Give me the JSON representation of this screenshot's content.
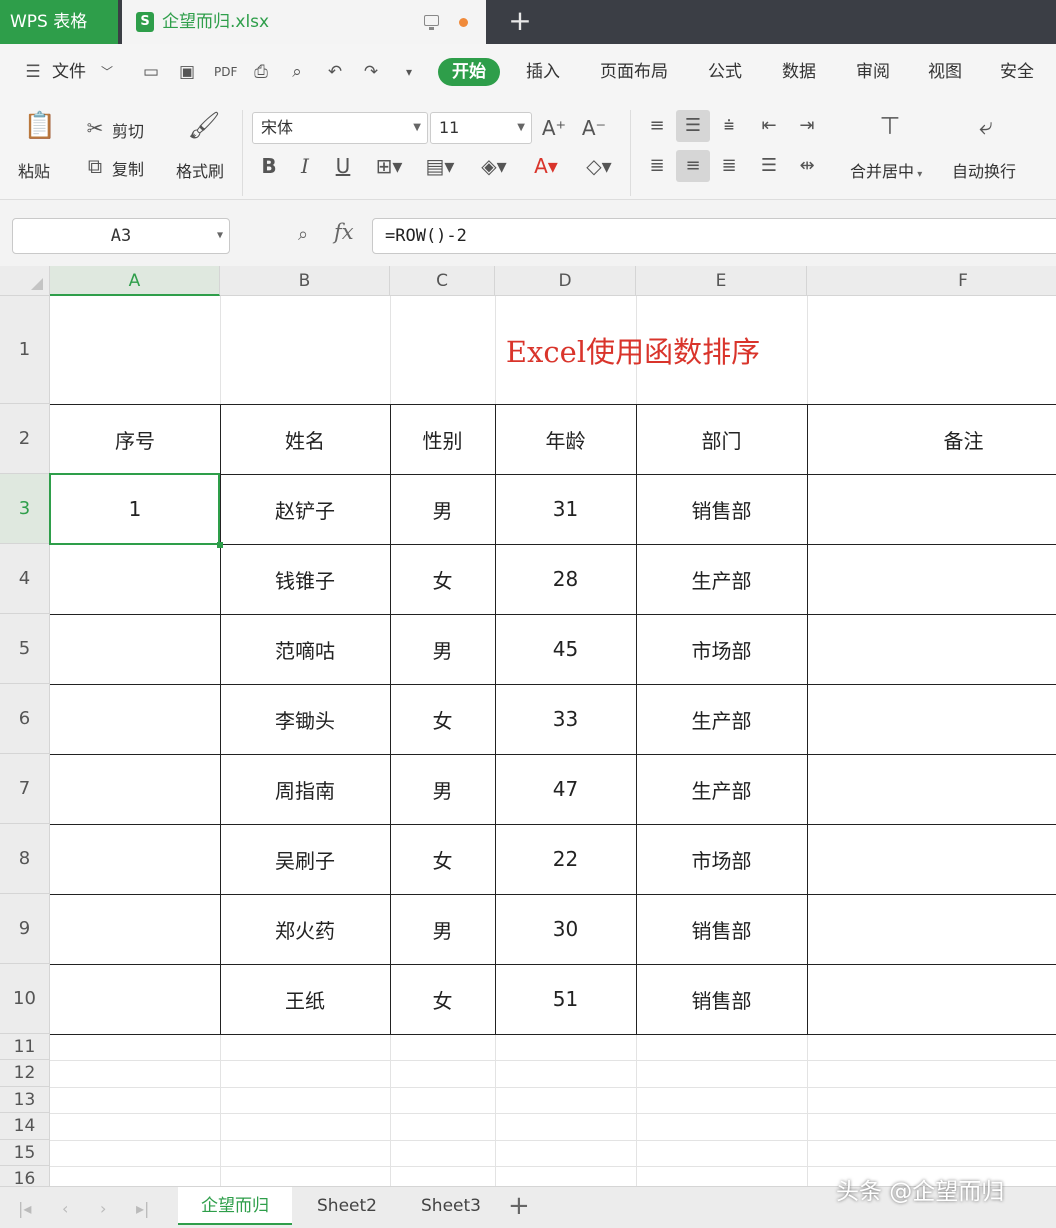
{
  "app": {
    "app_tab": "WPS 表格",
    "doc_tab": "企望而归.xlsx",
    "new_tab": "+"
  },
  "menu": {
    "file": "文件",
    "tabs": [
      "开始",
      "插入",
      "页面布局",
      "公式",
      "数据",
      "审阅",
      "视图",
      "安全"
    ]
  },
  "ribbon": {
    "paste": "粘贴",
    "cut": "剪切",
    "copy": "复制",
    "format_painter": "格式刷",
    "font_name": "宋体",
    "font_size": "11",
    "merge_center": "合并居中",
    "wrap_text": "自动换行"
  },
  "formula": {
    "name_box": "A3",
    "fx": "fx",
    "content": "=ROW()-2"
  },
  "grid": {
    "columns": [
      "A",
      "B",
      "C",
      "D",
      "E",
      "F"
    ],
    "rows": [
      "1",
      "2",
      "3",
      "4",
      "5",
      "6",
      "7",
      "8",
      "9",
      "10",
      "11",
      "12",
      "13",
      "14",
      "15",
      "16"
    ],
    "title": "Excel使用函数排序",
    "headers": [
      "序号",
      "姓名",
      "性别",
      "年龄",
      "部门",
      "备注"
    ],
    "data": [
      [
        "1",
        "赵铲子",
        "男",
        "31",
        "销售部",
        ""
      ],
      [
        "",
        "钱锥子",
        "女",
        "28",
        "生产部",
        ""
      ],
      [
        "",
        "范嘀咕",
        "男",
        "45",
        "市场部",
        ""
      ],
      [
        "",
        "李锄头",
        "女",
        "33",
        "生产部",
        ""
      ],
      [
        "",
        "周指南",
        "男",
        "47",
        "生产部",
        ""
      ],
      [
        "",
        "吴刷子",
        "女",
        "22",
        "市场部",
        ""
      ],
      [
        "",
        "郑火药",
        "男",
        "30",
        "销售部",
        ""
      ],
      [
        "",
        "王纸",
        "女",
        "51",
        "销售部",
        ""
      ]
    ]
  },
  "sheets": {
    "tabs": [
      "企望而归",
      "Sheet2",
      "Sheet3"
    ],
    "add": "+"
  },
  "watermark": "头条 @企望而归",
  "colors": {
    "accent": "#2e9e4a",
    "title_red": "#d9342b",
    "titlebar": "#3b3e45"
  }
}
